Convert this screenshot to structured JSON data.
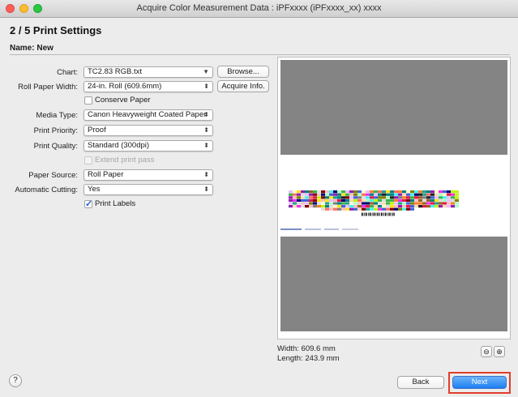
{
  "window": {
    "title": "Acquire Color Measurement Data : iPFxxxx (iPFxxxx_xx) xxxx"
  },
  "step": {
    "title": "2 / 5  Print Settings"
  },
  "name": {
    "label": "Name: New"
  },
  "form": {
    "chart": {
      "label": "Chart:",
      "value": "TC2.83 RGB.txt",
      "browse": "Browse..."
    },
    "roll_paper_width": {
      "label": "Roll Paper Width:",
      "value": "24-in. Roll (609.6mm)",
      "acquire": "Acquire Info."
    },
    "conserve_paper": {
      "label": "Conserve Paper",
      "checked": false
    },
    "media_type": {
      "label": "Media Type:",
      "value": "Canon Heavyweight Coated Paper"
    },
    "print_priority": {
      "label": "Print Priority:",
      "value": "Proof"
    },
    "print_quality": {
      "label": "Print Quality:",
      "value": "Standard (300dpi)"
    },
    "extend_print_pass": {
      "label": "Extend print pass",
      "checked": false,
      "enabled": false
    },
    "paper_source": {
      "label": "Paper Source:",
      "value": "Roll Paper"
    },
    "automatic_cutting": {
      "label": "Automatic Cutting:",
      "value": "Yes"
    },
    "print_labels": {
      "label": "Print Labels",
      "checked": true
    }
  },
  "preview": {
    "width_text": "Width: 609.6 mm",
    "length_text": "Length: 243.9 mm",
    "zoom_out_icon": "zoom-out-icon",
    "zoom_in_icon": "zoom-in-icon"
  },
  "footer": {
    "help": "?",
    "back": "Back",
    "next": "Next"
  },
  "colors": {
    "accent": "#1d7ef1",
    "highlight": "#e13c2a",
    "preview_grey": "#848484"
  }
}
